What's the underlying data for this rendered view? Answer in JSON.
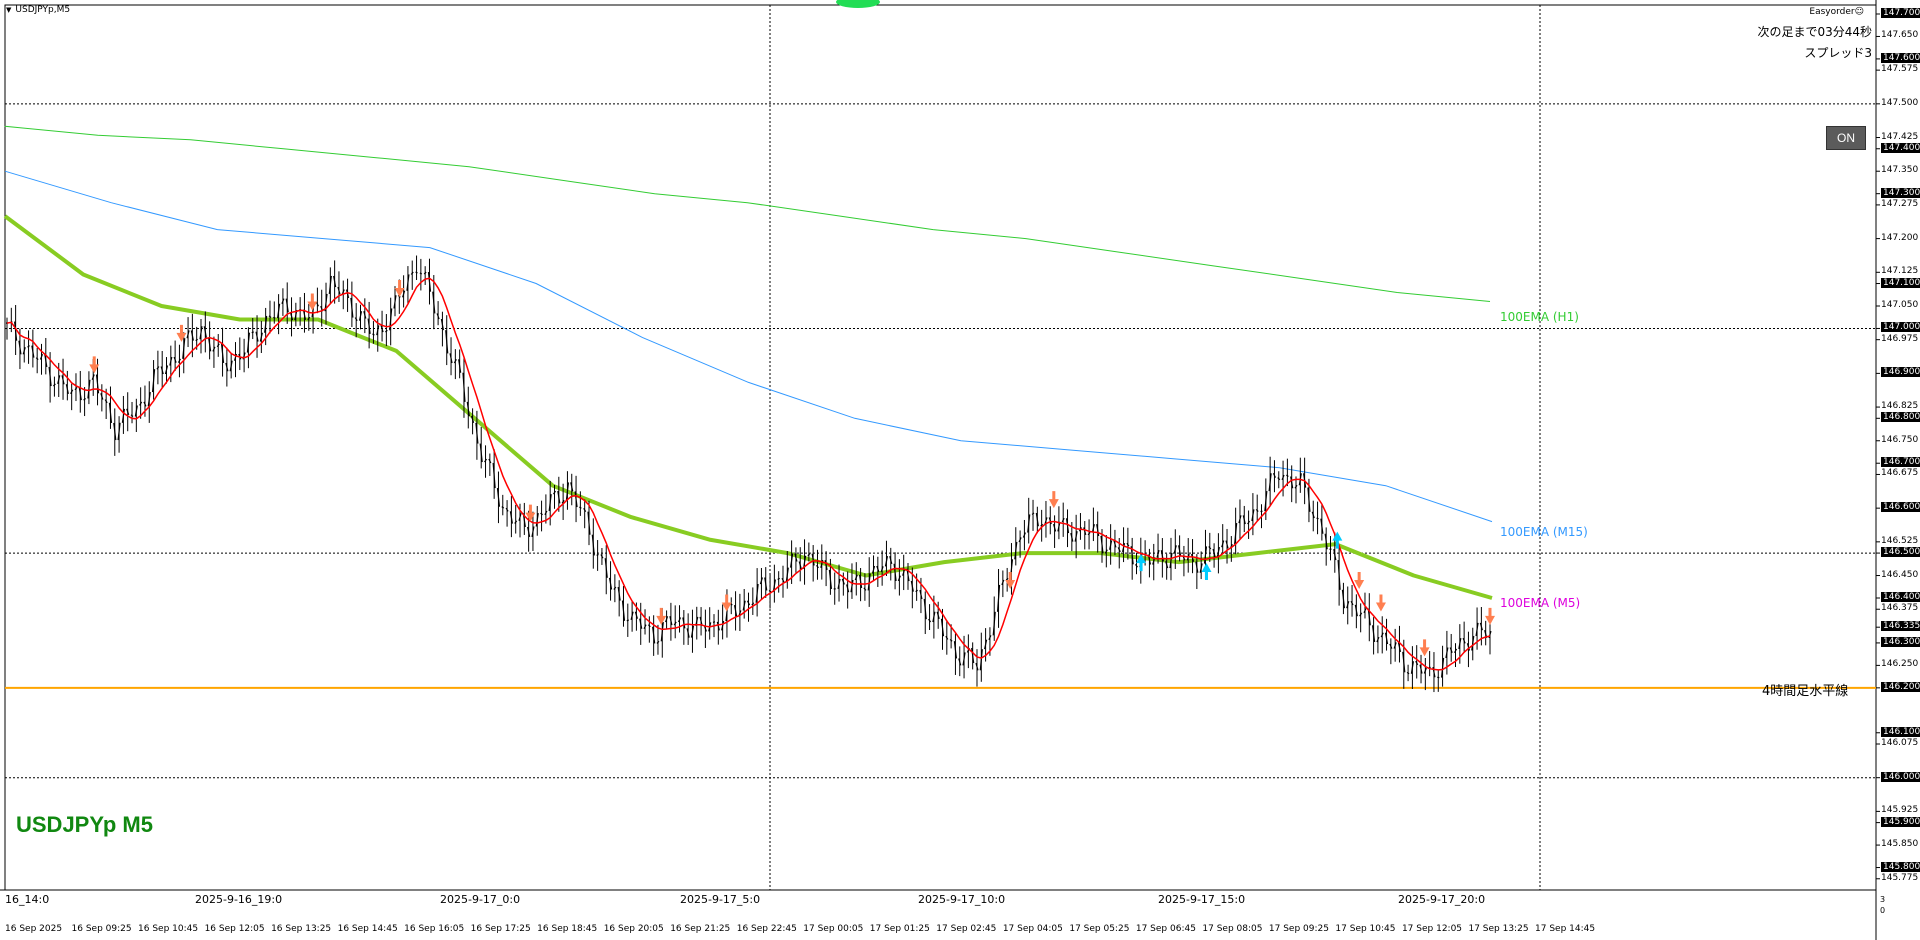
{
  "window": {
    "symbol_title": "USDJPYp,M5",
    "easyorder": "Easyorder☺",
    "countdown": "次の足まで03分44秒",
    "spread": "スプレッド3",
    "on_button": "ON",
    "symbol_watermark": "USDJPYp M5"
  },
  "horizontal_line_label": "4時間足水平線",
  "ema_labels": {
    "h1": "100EMA (H1)",
    "m15": "100EMA (M15)",
    "m5": "100EMA (M5)"
  },
  "colors": {
    "grid": "#000000",
    "h1_ema": "#33cc33",
    "m15_ema": "#3399ff",
    "m5_ema": "#88cc22",
    "fast_ma": "#ff0000",
    "horizontal_line": "#ffa500",
    "down_arrow": "#ff7f50",
    "up_arrow": "#00ccff",
    "m5_label": "#dd00dd"
  },
  "chart_data": {
    "type": "candlestick",
    "ylim": [
      145.75,
      147.72
    ],
    "price_levels": [
      "147.700",
      "147.650",
      "147.600",
      "147.575",
      "147.500",
      "147.425",
      "147.400",
      "147.350",
      "147.300",
      "147.275",
      "147.200",
      "147.125",
      "147.100",
      "147.050",
      "147.000",
      "146.975",
      "146.900",
      "146.825",
      "146.800",
      "146.750",
      "146.700",
      "146.675",
      "146.600",
      "146.525",
      "146.500",
      "146.450",
      "146.400",
      "146.375",
      "146.335",
      "146.300",
      "146.250",
      "146.200",
      "146.100",
      "146.075",
      "146.000",
      "145.925",
      "145.900",
      "145.850",
      "145.800",
      "145.775"
    ],
    "boxed_levels": [
      "147.700",
      "147.600",
      "147.400",
      "147.300",
      "147.100",
      "147.000",
      "146.900",
      "146.800",
      "146.700",
      "146.600",
      "146.500",
      "146.400",
      "146.335",
      "146.300",
      "146.200",
      "146.100",
      "146.000",
      "145.900",
      "145.800"
    ],
    "time_major": [
      "16_14:0",
      "2025-9-16_19:0",
      "2025-9-17_0:0",
      "2025-9-17_5:0",
      "2025-9-17_10:0",
      "2025-9-17_15:0",
      "2025-9-17_20:0"
    ],
    "time_minor": [
      "16 Sep 2025",
      "16 Sep 09:25",
      "16 Sep 10:45",
      "16 Sep 12:05",
      "16 Sep 13:25",
      "16 Sep 14:45",
      "16 Sep 16:05",
      "16 Sep 17:25",
      "16 Sep 18:45",
      "16 Sep 20:05",
      "16 Sep 21:25",
      "16 Sep 22:45",
      "17 Sep 00:05",
      "17 Sep 01:25",
      "17 Sep 02:45",
      "17 Sep 04:05",
      "17 Sep 05:25",
      "17 Sep 06:45",
      "17 Sep 08:05",
      "17 Sep 09:25",
      "17 Sep 10:45",
      "17 Sep 12:05",
      "17 Sep 13:25",
      "17 Sep 14:45"
    ],
    "horizontal_line_price": 146.2,
    "close_path": [
      147.0,
      146.95,
      146.9,
      146.85,
      146.88,
      146.78,
      146.82,
      146.9,
      146.95,
      147.0,
      146.92,
      146.95,
      147.02,
      147.05,
      147.02,
      147.1,
      147.05,
      146.98,
      147.05,
      147.15,
      147.02,
      146.88,
      146.72,
      146.6,
      146.55,
      146.6,
      146.65,
      146.55,
      146.42,
      146.35,
      146.32,
      146.35,
      146.33,
      146.35,
      146.38,
      146.42,
      146.45,
      146.5,
      146.45,
      146.42,
      146.45,
      146.48,
      146.42,
      146.35,
      146.28,
      146.25,
      146.4,
      146.55,
      146.58,
      146.55,
      146.55,
      146.52,
      146.5,
      146.48,
      146.5,
      146.48,
      146.5,
      146.55,
      146.6,
      146.68,
      146.65,
      146.55,
      146.4,
      146.35,
      146.3,
      146.25,
      146.23,
      146.28,
      146.32
    ],
    "ema_h1_path": [
      147.45,
      147.43,
      147.42,
      147.4,
      147.38,
      147.36,
      147.33,
      147.3,
      147.28,
      147.25,
      147.22,
      147.2,
      147.17,
      147.14,
      147.11,
      147.08,
      147.06
    ],
    "ema_m15_path": [
      147.35,
      147.28,
      147.22,
      147.2,
      147.18,
      147.1,
      146.98,
      146.88,
      146.8,
      146.75,
      146.73,
      146.71,
      146.69,
      146.65,
      146.57
    ],
    "ema_m5_path": [
      147.25,
      147.12,
      147.05,
      147.02,
      147.02,
      146.95,
      146.8,
      146.65,
      146.58,
      146.53,
      146.5,
      146.45,
      146.48,
      146.5,
      146.5,
      146.48,
      146.5,
      146.52,
      146.45,
      146.4
    ],
    "down_arrows_at": [
      4,
      8,
      14,
      18,
      24,
      30,
      33,
      46,
      48,
      62,
      63,
      65,
      68
    ],
    "up_arrows_at": [
      52,
      55,
      61
    ],
    "side_readout": [
      "3",
      "0"
    ]
  }
}
